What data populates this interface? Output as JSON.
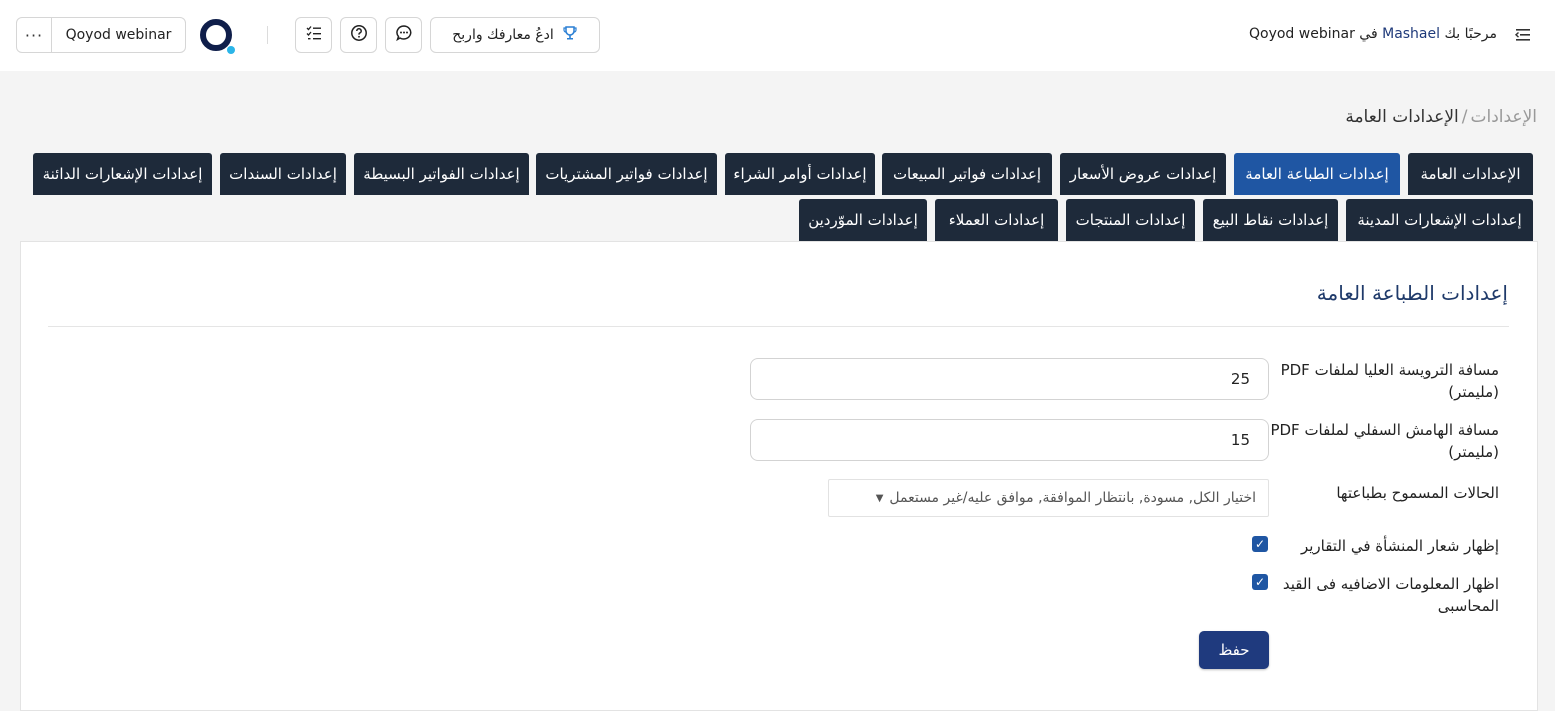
{
  "header": {
    "welcome_prefix": "مرحبًا بك",
    "username": "Mashael",
    "welcome_in": "في",
    "company": "Qoyod webinar",
    "challenge_label": "ادعُ معارفك واربح",
    "more_label": "···",
    "company_button_label": "Qoyod webinar",
    "icons": [
      "menu-toggle-icon",
      "trophy-icon",
      "chat-icon",
      "help-icon",
      "tasks-icon",
      "more-icon"
    ]
  },
  "breadcrumb": {
    "root": "الإعدادات",
    "separator": "/",
    "current": "الإعدادات العامة"
  },
  "tabs": {
    "row1": [
      "الإعدادات العامة",
      "إعدادات الطباعة العامة",
      "إعدادات عروض الأسعار",
      "إعدادات فواتير المبيعات",
      "إعدادات أوامر الشراء",
      "إعدادات فواتير المشتريات",
      "إعدادات الفواتير البسيطة",
      "إعدادات السندات",
      "إعدادات الإشعارات الدائنة"
    ],
    "row2": [
      "إعدادات الإشعارات المدينة",
      "إعدادات نقاط البيع",
      "إعدادات المنتجات",
      "إعدادات العملاء",
      "إعدادات الموّردين"
    ],
    "active": "إعدادات الطباعة العامة"
  },
  "panel": {
    "title": "إعدادات الطباعة العامة",
    "fields": {
      "top_header_label": "مسافة الترويسة العليا لملفات PDF (مليمتر)",
      "top_header_value": "25",
      "bottom_margin_label": "مسافة الهامش السفلي لملفات PDF (مليمتر)",
      "bottom_margin_value": "15",
      "allowed_statuses_label": "الحالات المسموح بطباعتها",
      "allowed_statuses_value": "اختيار الكل, مسودة, بانتظار الموافقة, موافق عليه/غير مستعمل",
      "show_logo_label": "إظهار شعار المنشأة في التقارير",
      "show_logo_checked": true,
      "show_extra_label": "اظهار المعلومات الاضافيه فى القيد المحاسبى",
      "show_extra_checked": true
    },
    "save_label": "حفظ"
  },
  "colors": {
    "tab": "#1e2a3a",
    "tab_active": "#1f56a3",
    "primary_button": "#1f3a7e",
    "title": "#1f3a6a",
    "logo_dark": "#0f1e4a",
    "logo_accent": "#2bb5e8"
  }
}
